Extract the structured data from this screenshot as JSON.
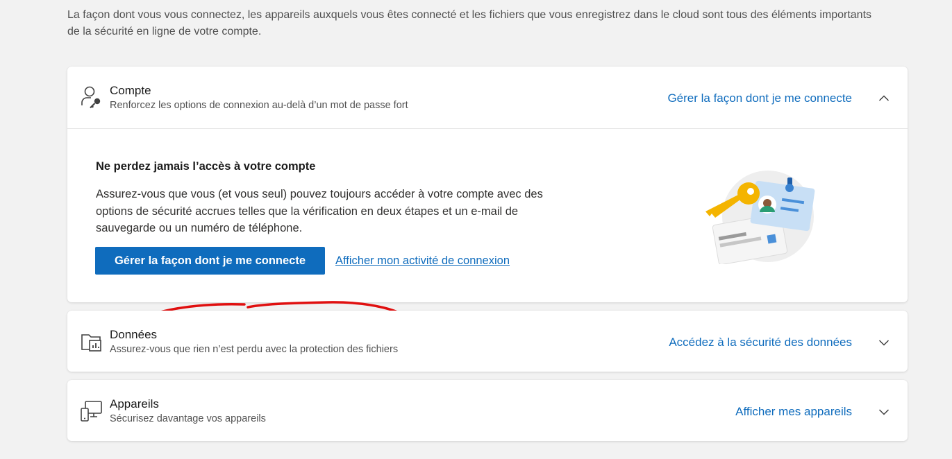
{
  "intro": "La façon dont vous vous connectez, les appareils auxquels vous êtes connecté et les fichiers que vous enregistrez dans le cloud sont tous des éléments importants de la sécurité en ligne de votre compte.",
  "sections": {
    "compte": {
      "title": "Compte",
      "subtitle": "Renforcez les options de connexion au-delà d’un mot de passe fort",
      "link": "Gérer la façon dont je me connecte",
      "expanded": true,
      "body_title": "Ne perdez jamais l’accès à votre compte",
      "body_text": "Assurez-vous que vous (et vous seul) pouvez toujours accéder à votre compte avec des options de sécurité accrues telles que la vérification en deux étapes et un e-mail de sauvegarde ou un numéro de téléphone.",
      "primary_button": "Gérer la façon dont je me connecte",
      "secondary_link": "Afficher mon activité de connexion"
    },
    "donnees": {
      "title": "Données",
      "subtitle": "Assurez-vous que rien n’est perdu avec la protection des fichiers",
      "link": "Accédez à la sécurité des données"
    },
    "appareils": {
      "title": "Appareils",
      "subtitle": "Sécurisez davantage vos appareils",
      "link": "Afficher mes appareils"
    }
  },
  "colors": {
    "accent": "#0f6cbd",
    "annotation": "#e01010"
  },
  "icons": [
    "person-key-icon",
    "folder-chart-icon",
    "devices-icon",
    "chevron-up-icon",
    "chevron-down-icon"
  ]
}
